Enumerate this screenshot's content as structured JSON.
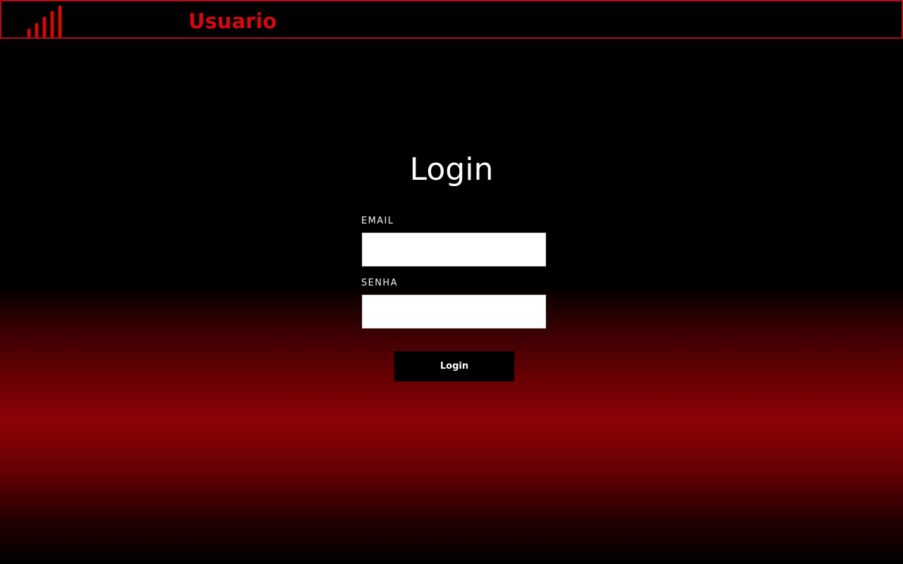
{
  "header": {
    "brand_label": "Usuario",
    "logo_icon": "signal-bars-icon",
    "accent_color": "#d2090d",
    "border_color": "#b10f14"
  },
  "login_form": {
    "title": "Login",
    "email_label": "EMAIL",
    "email_value": "",
    "password_label": "SENHA",
    "password_value": "",
    "submit_label": "Login"
  },
  "theme": {
    "background_top": "#000000",
    "background_glow": "#8d0306",
    "input_background": "#ffffff",
    "button_background": "#000000"
  }
}
